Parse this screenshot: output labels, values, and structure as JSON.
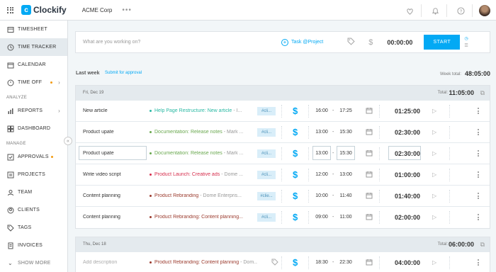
{
  "app": {
    "logo_letter": "c",
    "logo_text": "Clockify",
    "workspace": "ACME Corp",
    "workspace_menu": "•••",
    "top_icons": [
      "gift-icon",
      "bell-icon",
      "help-icon"
    ]
  },
  "sidebar": {
    "items": [
      {
        "label": "TIMESHEET",
        "icon": "timesheet-icon"
      },
      {
        "label": "TIME TRACKER",
        "icon": "clock-icon",
        "active": true
      },
      {
        "label": "CALENDAR",
        "icon": "calendar-icon"
      },
      {
        "label": "TIME OFF",
        "icon": "time-off-icon"
      }
    ],
    "analyze_label": "ANALYZE",
    "analyze_items": [
      {
        "label": "REPORTS",
        "icon": "reports-icon"
      },
      {
        "label": "DASHBOARD",
        "icon": "dashboard-icon"
      }
    ],
    "manage_label": "MANAGE",
    "manage_items": [
      {
        "label": "APPROVALS",
        "icon": "approvals-icon"
      },
      {
        "label": "PROJECTS",
        "icon": "projects-icon"
      },
      {
        "label": "TEAM",
        "icon": "team-icon"
      },
      {
        "label": "CLIENTS",
        "icon": "clients-icon"
      },
      {
        "label": "TAGS",
        "icon": "tags-icon"
      },
      {
        "label": "INVOICES",
        "icon": "invoices-icon"
      }
    ],
    "show_more": "SHOW MORE"
  },
  "tracker": {
    "placeholder": "What are you working on?",
    "project_label": "Task @Project",
    "time": "00:00:00",
    "start_label": "START"
  },
  "week": {
    "title": "Last week",
    "submit": "Submit for approval",
    "total_label": "Week total:",
    "total": "48:05:00"
  },
  "colors": {
    "accent": "#03a9f4",
    "teal": "#2bb9a4",
    "green": "#6aa84f",
    "red": "#d62e4d",
    "brown": "#9b3b2e"
  },
  "days": [
    {
      "label": "Fri, Dec 19",
      "total_label": "Total:",
      "total": "11:05:00",
      "entries": [
        {
          "desc": "New article",
          "project": "Help Page Restructure: New article",
          "client": "- I...",
          "pcolor": "#2bb9a4",
          "tag": "#cli...",
          "start": "16:00",
          "end": "17:25",
          "duration": "01:25:00"
        },
        {
          "desc": "Product upate",
          "project": "Documentation: Release notes",
          "client": "- Mark ...",
          "pcolor": "#6aa84f",
          "tag": "#cli...",
          "start": "13:00",
          "end": "15:30",
          "duration": "02:30:00"
        },
        {
          "desc": "Product upate",
          "project": "Documentation: Release notes",
          "client": "- Mark ...",
          "pcolor": "#6aa84f",
          "tag": "#cli...",
          "start": "13:00",
          "end": "15:30",
          "duration": "02:30:00",
          "highlight": true
        },
        {
          "desc": "Write video script",
          "project": "Product Launch: Creative ads",
          "client": "- Dome ...",
          "pcolor": "#d62e4d",
          "tag": "#cli...",
          "start": "12:00",
          "end": "13:00",
          "duration": "01:00:00"
        },
        {
          "desc": "Content planning",
          "project": "Product Rebranding",
          "client": "- Dome Enterpris...",
          "pcolor": "#9b3b2e",
          "tag": "#clie...",
          "start": "10:00",
          "end": "11:40",
          "duration": "01:40:00"
        },
        {
          "desc": "Content planning",
          "project": "Product Rebranding: Content planning...",
          "client": "",
          "pcolor": "#9b3b2e",
          "tag": "#cli...",
          "start": "09:00",
          "end": "11:00",
          "duration": "02:00:00"
        }
      ]
    },
    {
      "label": "Thu, Dec 18",
      "total_label": "Total:",
      "total": "06:00:00",
      "entries": [
        {
          "desc": "Add description",
          "placeholder": true,
          "project": "Product Rebranding: Content planning",
          "client": "- Dom...",
          "pcolor": "#9b3b2e",
          "tag": "",
          "start": "18:30",
          "end": "22:30",
          "duration": "04:00:00"
        }
      ]
    }
  ]
}
